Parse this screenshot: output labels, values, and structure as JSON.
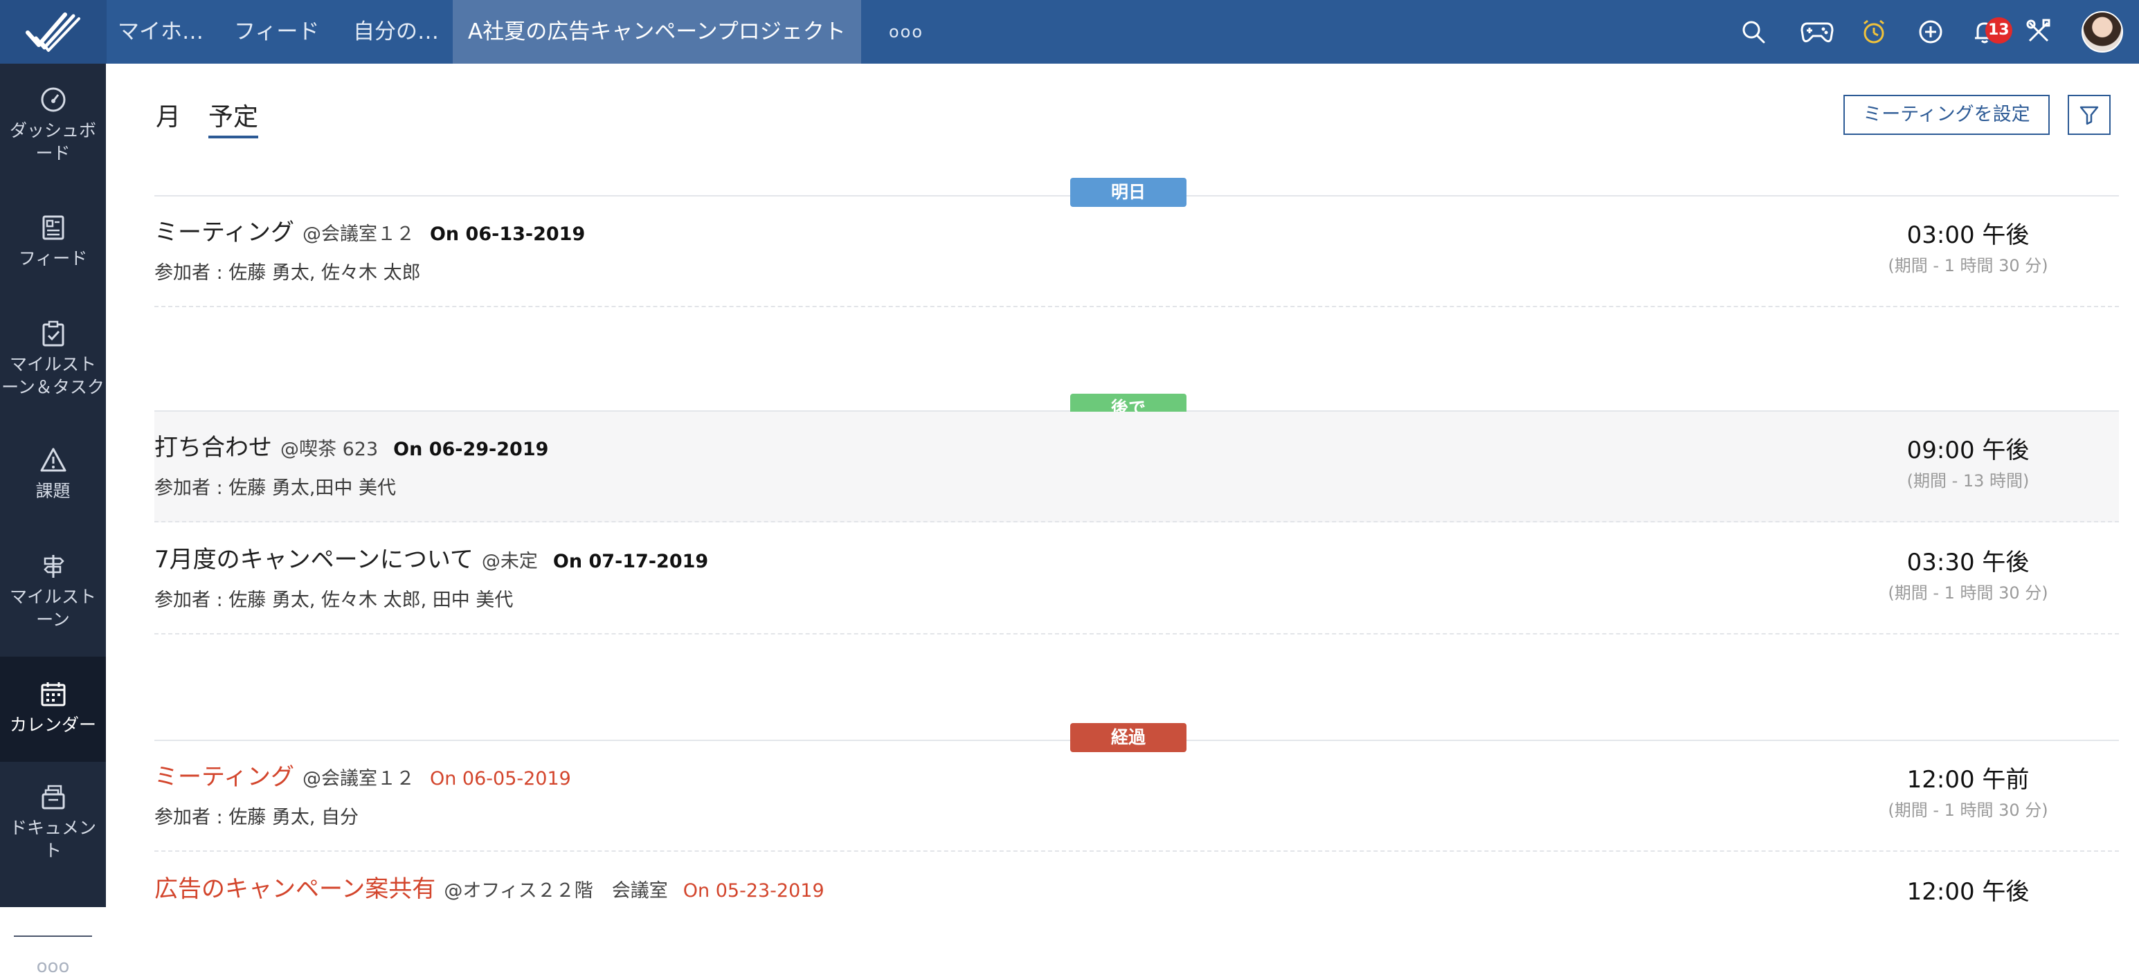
{
  "topbar": {
    "tabs": [
      "マイホ…",
      "フィード",
      "自分の…"
    ],
    "active_tab": "A社夏の広告キャンペーンプロジェクト",
    "more": "ooo",
    "notification_count": "13",
    "icons": [
      "search-icon",
      "gamepad-icon",
      "timer-icon",
      "add-icon",
      "bell-icon",
      "tools-icon"
    ]
  },
  "sidebar": {
    "items": [
      {
        "label": "ダッシュボード",
        "icon": "dashboard-icon"
      },
      {
        "label": "フィード",
        "icon": "feed-icon"
      },
      {
        "label": "マイルストーン＆タスク",
        "icon": "tasks-icon"
      },
      {
        "label": "課題",
        "icon": "warning-icon"
      },
      {
        "label": "マイルストーン",
        "icon": "signpost-icon"
      },
      {
        "label": "カレンダー",
        "icon": "calendar-icon",
        "active": true
      },
      {
        "label": "ドキュメント",
        "icon": "documents-icon"
      }
    ],
    "more": "ooo"
  },
  "view_tabs": {
    "month": "月",
    "schedule": "予定"
  },
  "actions": {
    "set_meeting": "ミーティングを設定",
    "filter_icon": "filter-icon"
  },
  "sections": {
    "tomorrow": {
      "label": "明日",
      "color": "#5a9ad6"
    },
    "later": {
      "label": "後で",
      "color": "#6cc97a"
    },
    "past": {
      "label": "経過",
      "color": "#c9503c"
    }
  },
  "events": [
    {
      "name": "ミーティング",
      "location": "@会議室１２",
      "date": "On 06-13-2019",
      "participants": "参加者 : 佐藤 勇太, 佐々木 太郎",
      "time": "03:00 午後",
      "duration": "(期間 - 1 時間 30 分)"
    },
    {
      "name": "打ち合わせ",
      "location": "@喫茶 623",
      "date": "On 06-29-2019",
      "participants": "参加者 : 佐藤 勇太,田中 美代",
      "time": "09:00 午後",
      "duration": "(期間 - 13 時間)"
    },
    {
      "name": "7月度のキャンペーンについて",
      "location": "@未定",
      "date": "On 07-17-2019",
      "participants": "参加者 : 佐藤 勇太, 佐々木 太郎, 田中 美代",
      "time": "03:30 午後",
      "duration": "(期間 - 1 時間 30 分)"
    },
    {
      "name": "ミーティング",
      "location": "@会議室１２",
      "date": "On 06-05-2019",
      "participants": "参加者 : 佐藤 勇太, 自分",
      "time": "12:00 午前",
      "duration": "(期間 - 1 時間 30 分)"
    },
    {
      "name": "広告のキャンペーン案共有",
      "location": "@オフィス２２階　会議室",
      "date": "On 05-23-2019",
      "participants": "",
      "time": "12:00 午後",
      "duration": ""
    }
  ]
}
